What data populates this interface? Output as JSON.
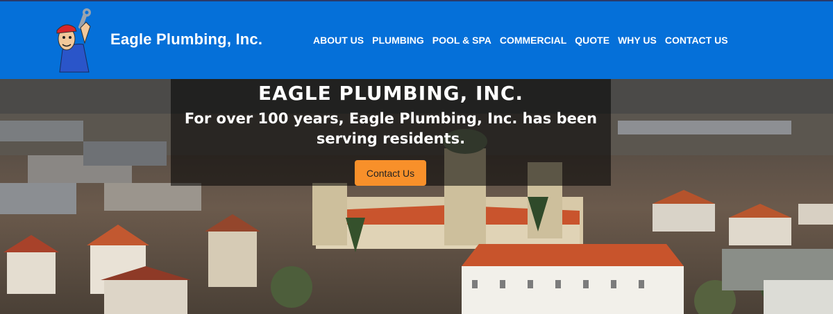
{
  "brand": {
    "name": "Eagle Plumbing, Inc.",
    "logo_icon": "plumber-mascot-icon"
  },
  "nav": {
    "items": [
      {
        "label": "ABOUT US"
      },
      {
        "label": "PLUMBING"
      },
      {
        "label": "POOL & SPA"
      },
      {
        "label": "COMMERCIAL"
      },
      {
        "label": "QUOTE"
      },
      {
        "label": "WHY US"
      },
      {
        "label": "CONTACT US"
      }
    ]
  },
  "hero": {
    "title": "EAGLE PLUMBING, INC.",
    "subtitle": "For over 100 years, Eagle Plumbing, Inc. has been serving residents.",
    "button_label": "Contact Us"
  },
  "colors": {
    "navbar": "#0570d9",
    "button": "#f8902a",
    "overlay": "rgba(0,0,0,0.55)"
  }
}
